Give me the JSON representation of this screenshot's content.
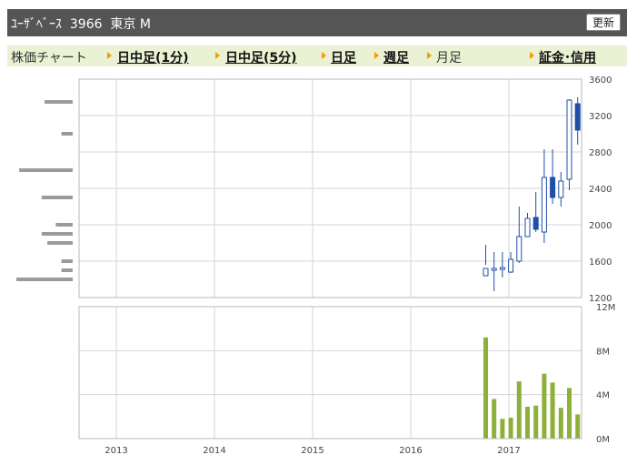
{
  "header": {
    "title": "ﾕｰｻﾞﾍﾞｰｽ  3966  東京 M",
    "refresh_label": "更新"
  },
  "tabs": [
    {
      "label": "株価チャート",
      "link": false,
      "arrow": false
    },
    {
      "label": "日中足(1分)",
      "link": true,
      "arrow": true
    },
    {
      "label": "日中足(5分)",
      "link": true,
      "arrow": true
    },
    {
      "label": "日足",
      "link": true,
      "arrow": true
    },
    {
      "label": "週足",
      "link": true,
      "arrow": true
    },
    {
      "label": "月足",
      "link": false,
      "arrow": true
    },
    {
      "label": "証金･信用",
      "link": true,
      "arrow": true
    }
  ],
  "chart_data": {
    "type": "candlestick",
    "x_ticks": [
      "2013",
      "2014",
      "2015",
      "2016",
      "2017"
    ],
    "price_axis": {
      "ticks": [
        "3600",
        "3200",
        "2800",
        "2400",
        "2000",
        "1600",
        "1200"
      ],
      "ylim": [
        1200,
        3600
      ]
    },
    "volume_axis": {
      "ticks": [
        "12M",
        "8M",
        "4M",
        "0M"
      ],
      "ylim": [
        0,
        12
      ]
    },
    "candles": [
      {
        "month": "2016-10",
        "open": 1440,
        "high": 1780,
        "low": 1560,
        "close": 1520
      },
      {
        "month": "2016-11",
        "open": 1500,
        "high": 1700,
        "low": 1270,
        "close": 1520
      },
      {
        "month": "2016-12",
        "open": 1510,
        "high": 1700,
        "low": 1420,
        "close": 1530
      },
      {
        "month": "2017-01",
        "open": 1480,
        "high": 1700,
        "low": 1470,
        "close": 1620
      },
      {
        "month": "2017-02",
        "open": 1600,
        "high": 2200,
        "low": 1580,
        "close": 1870
      },
      {
        "month": "2017-03",
        "open": 1870,
        "high": 2130,
        "low": 1880,
        "close": 2070
      },
      {
        "month": "2017-04",
        "open": 2080,
        "high": 2360,
        "low": 1920,
        "close": 1950
      },
      {
        "month": "2017-05",
        "open": 1920,
        "high": 2830,
        "low": 1800,
        "close": 2520
      },
      {
        "month": "2017-06",
        "open": 2520,
        "high": 2830,
        "low": 2230,
        "close": 2300
      },
      {
        "month": "2017-07",
        "open": 2300,
        "high": 2580,
        "low": 2200,
        "close": 2480
      },
      {
        "month": "2017-08",
        "open": 2500,
        "high": 3380,
        "low": 2380,
        "close": 3370
      },
      {
        "month": "2017-09",
        "open": 3330,
        "high": 3400,
        "low": 2880,
        "close": 3040
      }
    ],
    "volume_unit": "M",
    "volumes": [
      9.2,
      3.6,
      1.8,
      1.9,
      5.2,
      2.9,
      3.0,
      5.9,
      5.1,
      2.8,
      4.6,
      2.2
    ],
    "volume_by_price": [
      {
        "price": 3350,
        "volume": 0.5
      },
      {
        "price": 3000,
        "volume": 0.2
      },
      {
        "price": 2600,
        "volume": 0.95
      },
      {
        "price": 2300,
        "volume": 0.55
      },
      {
        "price": 2000,
        "volume": 0.3
      },
      {
        "price": 1900,
        "volume": 0.55
      },
      {
        "price": 1800,
        "volume": 0.45
      },
      {
        "price": 1600,
        "volume": 0.2
      },
      {
        "price": 1500,
        "volume": 0.2
      },
      {
        "price": 1400,
        "volume": 1.0
      }
    ],
    "colors": {
      "up_body": "#ffffff",
      "down_body": "#1f4fa8",
      "candle_outline": "#1f4fa8",
      "volume_bar": "#8db038",
      "price_volume_bar": "#9b9b9b",
      "grid": "#d6d6d6",
      "frame": "#b8b8b8"
    }
  }
}
